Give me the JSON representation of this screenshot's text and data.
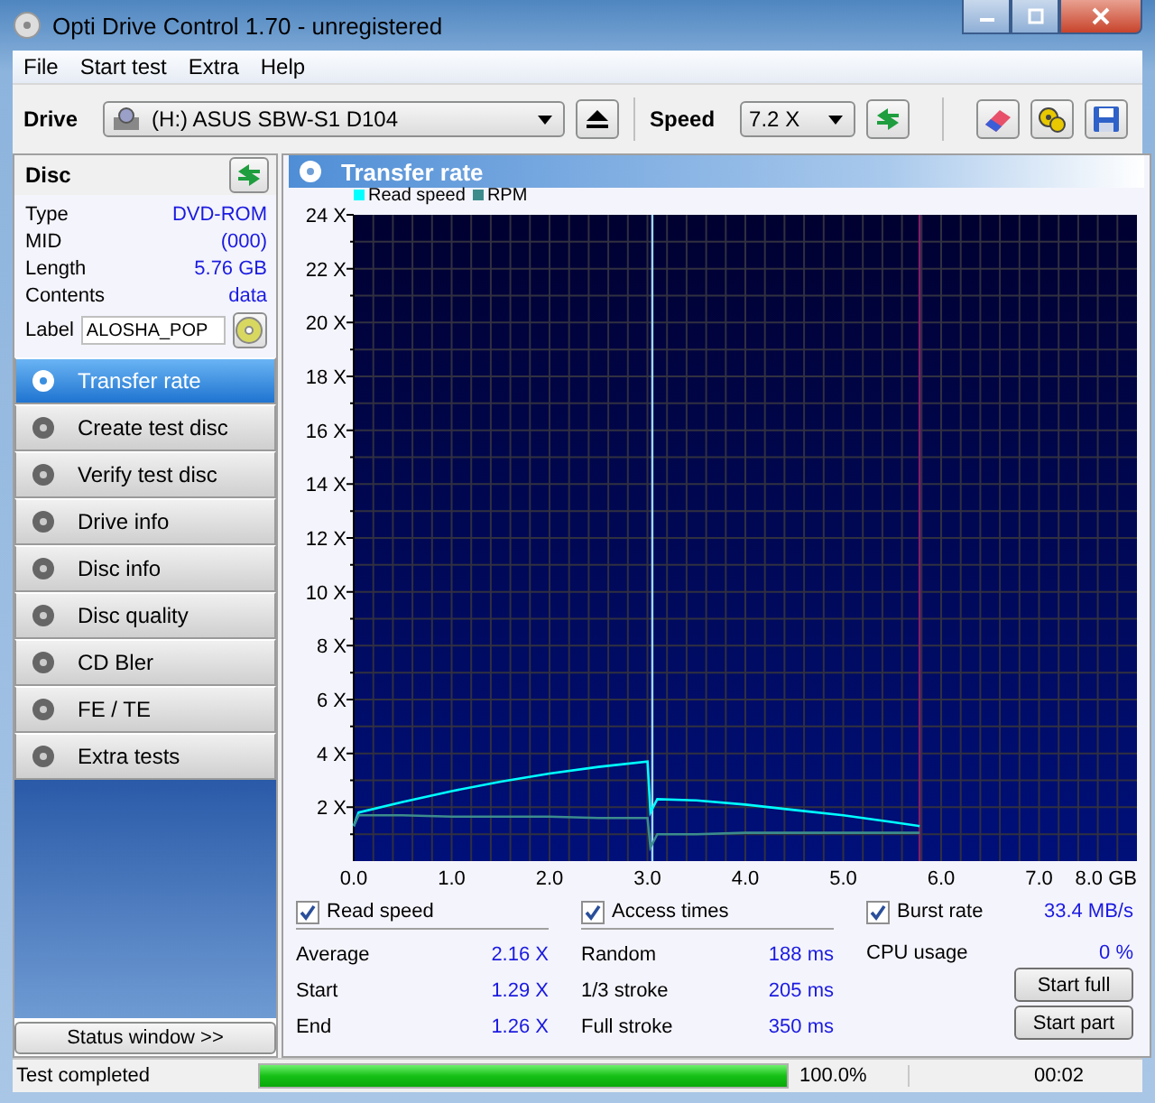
{
  "window": {
    "title": "Opti Drive Control 1.70 - unregistered"
  },
  "menu": [
    "File",
    "Start test",
    "Extra",
    "Help"
  ],
  "toolbar": {
    "drive_label": "Drive",
    "drive_value": "(H:)   ASUS SBW-S1 D104",
    "speed_label": "Speed",
    "speed_value": "7.2 X"
  },
  "disc": {
    "title": "Disc",
    "fields": [
      {
        "label": "Type",
        "value": "DVD-ROM"
      },
      {
        "label": "MID",
        "value": "(000)"
      },
      {
        "label": "Length",
        "value": "5.76 GB"
      },
      {
        "label": "Contents",
        "value": "data"
      }
    ],
    "label_field": {
      "label": "Label",
      "value": "ALOSHA_POP"
    }
  },
  "nav": [
    {
      "label": "Transfer rate",
      "selected": true
    },
    {
      "label": "Create test disc",
      "selected": false
    },
    {
      "label": "Verify test disc",
      "selected": false
    },
    {
      "label": "Drive info",
      "selected": false
    },
    {
      "label": "Disc info",
      "selected": false
    },
    {
      "label": "Disc quality",
      "selected": false
    },
    {
      "label": "CD Bler",
      "selected": false
    },
    {
      "label": "FE / TE",
      "selected": false
    },
    {
      "label": "Extra tests",
      "selected": false
    }
  ],
  "status_window_button": "Status window >>",
  "panel": {
    "title": "Transfer rate",
    "chart_data": {
      "type": "line",
      "x": [
        0,
        0.05,
        0.5,
        1,
        1.5,
        2,
        2.5,
        3.0,
        3.03,
        3.1,
        3.5,
        4,
        4.5,
        5,
        5.5,
        5.78
      ],
      "series": [
        {
          "name": "Read speed",
          "color": "#00ffff",
          "values": [
            1.3,
            1.8,
            2.2,
            2.6,
            2.95,
            3.25,
            3.5,
            3.7,
            1.8,
            2.3,
            2.25,
            2.1,
            1.9,
            1.7,
            1.45,
            1.3
          ]
        },
        {
          "name": "RPM",
          "color": "#3c8c8c",
          "values": [
            1.3,
            1.7,
            1.7,
            1.65,
            1.65,
            1.65,
            1.6,
            1.6,
            0.5,
            1.0,
            1.0,
            1.05,
            1.05,
            1.05,
            1.05,
            1.05
          ]
        }
      ],
      "xlim": [
        0,
        8
      ],
      "ylim": [
        0,
        24
      ],
      "xticks": [
        {
          "value": 0,
          "label": "0.0"
        },
        {
          "value": 1,
          "label": "1.0"
        },
        {
          "value": 2,
          "label": "2.0"
        },
        {
          "value": 3,
          "label": "3.0"
        },
        {
          "value": 4,
          "label": "4.0"
        },
        {
          "value": 5,
          "label": "5.0"
        },
        {
          "value": 6,
          "label": "6.0"
        },
        {
          "value": 7,
          "label": "7.0"
        },
        {
          "value": 8,
          "label": "8.0 GB"
        }
      ],
      "yticks": [
        {
          "value": 2,
          "label": "2 X"
        },
        {
          "value": 4,
          "label": "4 X"
        },
        {
          "value": 6,
          "label": "6 X"
        },
        {
          "value": 8,
          "label": "8 X"
        },
        {
          "value": 10,
          "label": "10 X"
        },
        {
          "value": 12,
          "label": "12 X"
        },
        {
          "value": 14,
          "label": "14 X"
        },
        {
          "value": 16,
          "label": "16 X"
        },
        {
          "value": 18,
          "label": "18 X"
        },
        {
          "value": 20,
          "label": "20 X"
        },
        {
          "value": 22,
          "label": "22 X"
        },
        {
          "value": 24,
          "label": "24 X"
        }
      ],
      "grid": true,
      "ref_lines": [
        {
          "axis": "x",
          "value": 3.05,
          "color": "#a0d8ff"
        },
        {
          "axis": "x",
          "value": 5.78,
          "color": "#80206a"
        }
      ]
    }
  },
  "stats": [
    {
      "label": "Read speed",
      "checked": true,
      "rows": [
        {
          "label": "Average",
          "value": "2.16 X"
        },
        {
          "label": "Start",
          "value": "1.29 X"
        },
        {
          "label": "End",
          "value": "1.26 X"
        }
      ]
    },
    {
      "label": "Access times",
      "checked": true,
      "rows": [
        {
          "label": "Random",
          "value": "188 ms"
        },
        {
          "label": "1/3 stroke",
          "value": "205 ms"
        },
        {
          "label": "Full stroke",
          "value": "350 ms"
        }
      ]
    },
    {
      "label": "Burst rate",
      "checked": true,
      "value": "33.4 MB/s",
      "rows": [
        {
          "label": "CPU usage",
          "value": "0 %"
        }
      ]
    }
  ],
  "buttons": [
    "Start full",
    "Start part"
  ],
  "status_bar": {
    "text": "Test completed",
    "progress": {
      "level": 1,
      "reading": "100.0%"
    },
    "time": "00:02"
  }
}
